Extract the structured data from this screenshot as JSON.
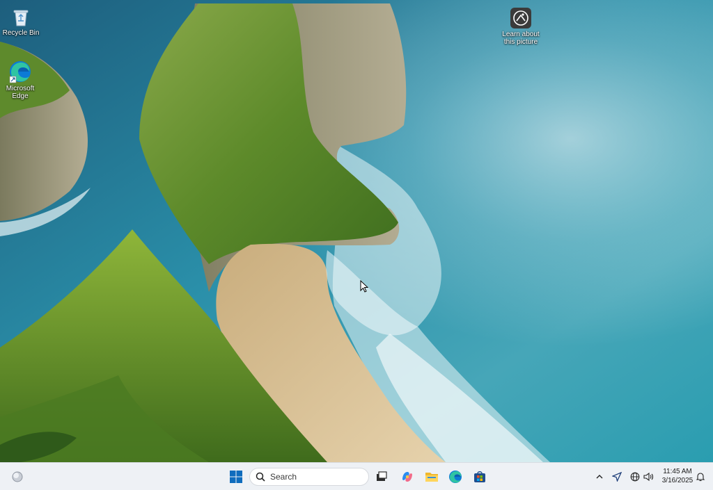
{
  "desktop": {
    "icons": [
      {
        "id": "recycle-bin",
        "label": "Recycle Bin"
      },
      {
        "id": "microsoft-edge",
        "label": "Microsoft Edge"
      },
      {
        "id": "learn-about-picture",
        "label": "Learn about this picture"
      }
    ]
  },
  "taskbar": {
    "search": {
      "label": "Search"
    },
    "pinned": [
      {
        "name": "start",
        "icon": "windows-logo-icon"
      },
      {
        "name": "task-view",
        "icon": "task-view-icon"
      },
      {
        "name": "copilot",
        "icon": "copilot-icon"
      },
      {
        "name": "file-explorer",
        "icon": "folder-icon"
      },
      {
        "name": "edge",
        "icon": "edge-icon"
      },
      {
        "name": "store",
        "icon": "store-icon"
      }
    ],
    "tray": {
      "time": "11:45 AM",
      "date": "3/16/2025",
      "icons": [
        "chevron-up-icon",
        "location-icon",
        "globe-icon",
        "speaker-icon",
        "bell-icon"
      ]
    },
    "widgets_icon": "weather-widget-icon"
  },
  "colors": {
    "taskbar_bg": "#eef1f5",
    "windows_blue": "#0f6cbd",
    "sea": "#1e7f97",
    "cliff_green": "#6d9a2c",
    "sand": "#dcc49a"
  }
}
